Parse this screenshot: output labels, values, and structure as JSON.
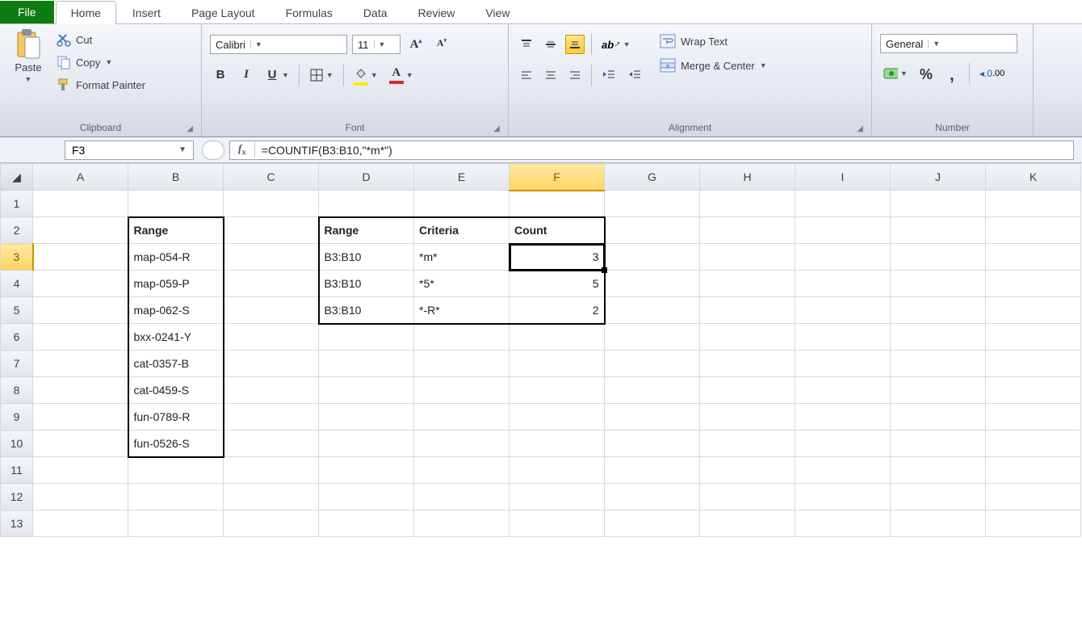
{
  "tabs": {
    "file": "File",
    "home": "Home",
    "insert": "Insert",
    "page_layout": "Page Layout",
    "formulas": "Formulas",
    "data": "Data",
    "review": "Review",
    "view": "View"
  },
  "clipboard": {
    "paste": "Paste",
    "cut": "Cut",
    "copy": "Copy",
    "format_painter": "Format Painter",
    "group": "Clipboard"
  },
  "font": {
    "name": "Calibri",
    "size": "11",
    "bold": "B",
    "italic": "I",
    "underline": "U",
    "group": "Font"
  },
  "alignment": {
    "wrap": "Wrap Text",
    "merge": "Merge & Center",
    "group": "Alignment"
  },
  "number": {
    "format": "General",
    "group": "Number",
    "percent": "%",
    "comma": ",",
    "inc": ".0"
  },
  "fbar": {
    "namebox": "F3",
    "formula": "=COUNTIF(B3:B10,\"*m*\")"
  },
  "columns": [
    "A",
    "B",
    "C",
    "D",
    "E",
    "F",
    "G",
    "H",
    "I",
    "J",
    "K"
  ],
  "rows": [
    "1",
    "2",
    "3",
    "4",
    "5",
    "6",
    "7",
    "8",
    "9",
    "10",
    "11",
    "12",
    "13"
  ],
  "data": {
    "B2": "Range",
    "B3": "map-054-R",
    "B4": "map-059-P",
    "B5": "map-062-S",
    "B6": "bxx-0241-Y",
    "B7": "cat-0357-B",
    "B8": "cat-0459-S",
    "B9": "fun-0789-R",
    "B10": "fun-0526-S",
    "D2": "Range",
    "E2": "Criteria",
    "F2": "Count",
    "D3": "B3:B10",
    "E3": "*m*",
    "F3": "3",
    "D4": "B3:B10",
    "E4": "*5*",
    "F4": "5",
    "D5": "B3:B10",
    "E5": "*-R*",
    "F5": "2"
  },
  "active": "F3",
  "chart_data": {
    "type": "table",
    "range_values": [
      "map-054-R",
      "map-059-P",
      "map-062-S",
      "bxx-0241-Y",
      "cat-0357-B",
      "cat-0459-S",
      "fun-0789-R",
      "fun-0526-S"
    ],
    "results": [
      {
        "range": "B3:B10",
        "criteria": "*m*",
        "count": 3
      },
      {
        "range": "B3:B10",
        "criteria": "*5*",
        "count": 5
      },
      {
        "range": "B3:B10",
        "criteria": "*-R*",
        "count": 2
      }
    ],
    "formula_shown": "=COUNTIF(B3:B10,\"*m*\")",
    "active_cell": "F3"
  }
}
